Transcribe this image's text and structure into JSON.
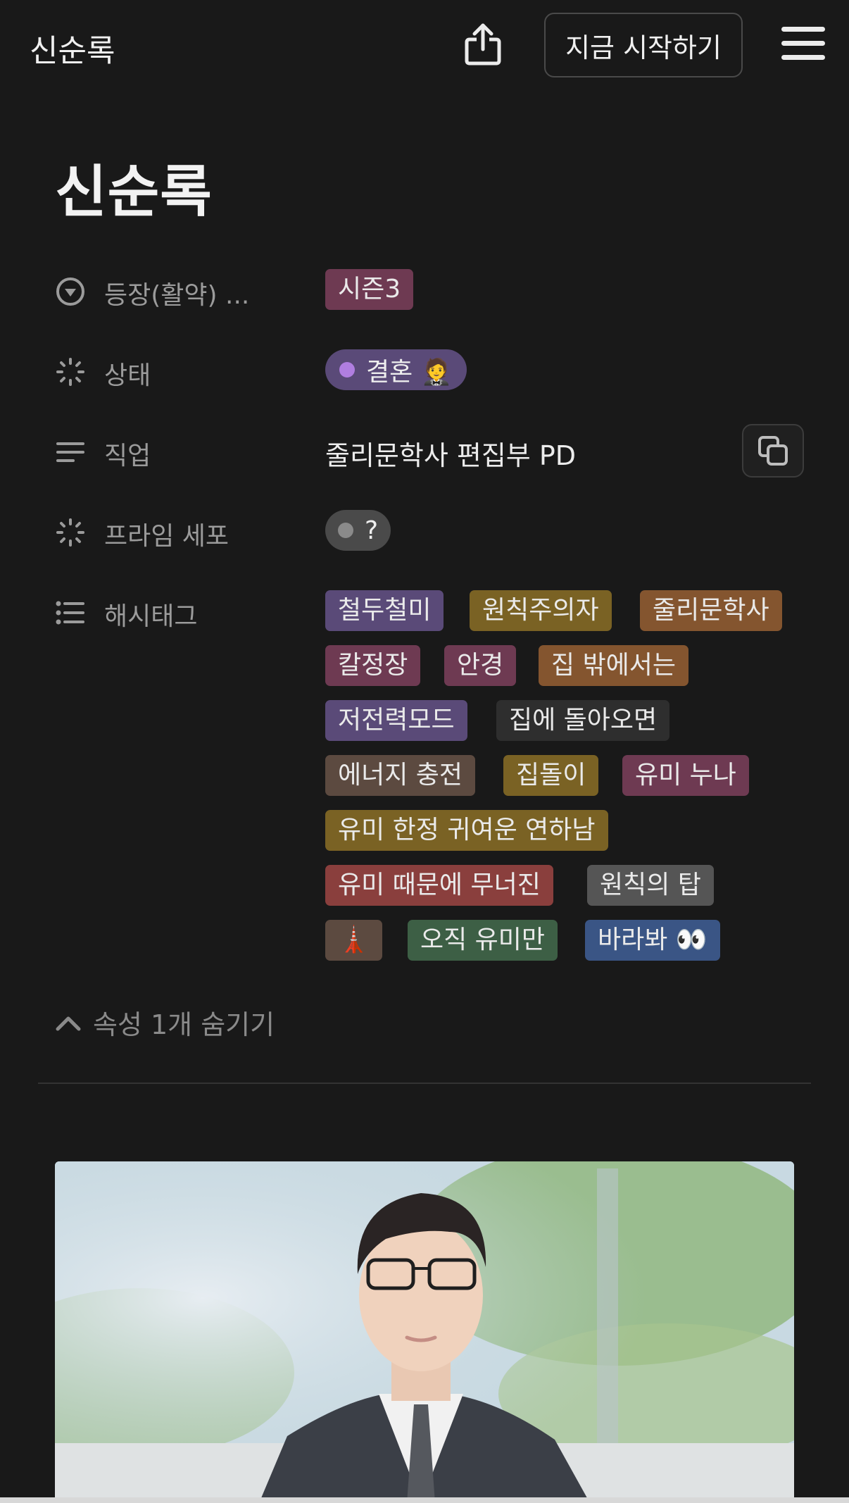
{
  "topbar": {
    "brand": "신순록",
    "share_icon": "share-icon",
    "start_label": "지금 시작하기",
    "menu_icon": "hamburger-menu-icon"
  },
  "page": {
    "title": "신순록"
  },
  "properties": [
    {
      "icon": "select-circle-icon",
      "label": "등장(활약) ...",
      "type": "tag",
      "value": "시즌3"
    },
    {
      "icon": "status-spinner-icon",
      "label": "상태",
      "type": "status",
      "value": "결혼 🤵"
    },
    {
      "icon": "text-lines-icon",
      "label": "직업",
      "type": "text",
      "value": "줄리문학사 편집부 PD"
    },
    {
      "icon": "status-spinner-icon",
      "label": "프라임 세포",
      "type": "status",
      "value": "?"
    },
    {
      "icon": "list-icon",
      "label": "해시태그",
      "type": "multi_select"
    }
  ],
  "hashtags": [
    {
      "label": "철두철미",
      "color": "#5a4a78"
    },
    {
      "label": "원칙주의자",
      "color": "#7a6224"
    },
    {
      "label": "줄리문학사",
      "color": "#84552f"
    },
    {
      "label": "칼정장",
      "color": "#6e3a52"
    },
    {
      "label": "안경",
      "color": "#6e3a52"
    },
    {
      "label": "집 밖에서는",
      "color": "#84552f"
    },
    {
      "label": "저전력모드",
      "color": "#5a4a78"
    },
    {
      "label": "집에 돌아오면",
      "color": "#2e2e2e"
    },
    {
      "label": "에너지 충전",
      "color": "#5c4a40"
    },
    {
      "label": "집돌이",
      "color": "#7a6224"
    },
    {
      "label": "유미 누나",
      "color": "#6e3a52"
    },
    {
      "label": "유미 한정 귀여운 연하남",
      "color": "#7a6224"
    },
    {
      "label": "유미 때문에 무너진",
      "color": "#8a3f3d"
    },
    {
      "label": "원칙의 탑",
      "color": "#555555"
    },
    {
      "label": "🗼",
      "color": "#5c4a40"
    },
    {
      "label": "오직 유미만",
      "color": "#3d5f45"
    },
    {
      "label": "바라봐 👀",
      "color": "#3a5585"
    }
  ],
  "colors": {
    "season_tag": "#6e3a52",
    "status_married_bg": "#5a4a78",
    "status_married_dot": "#b07ee0",
    "status_unknown_bg": "#4a4a4a",
    "status_unknown_dot": "#8a8a8a"
  },
  "footer": {
    "hide_props_label": "속성 1개 숨기기"
  }
}
